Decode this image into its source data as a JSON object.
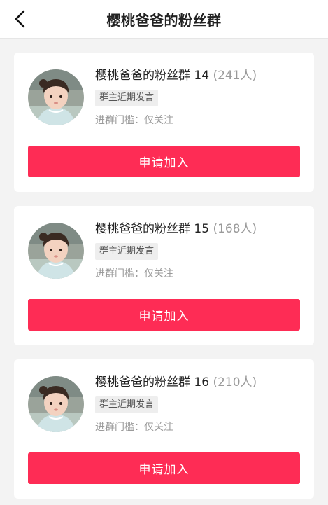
{
  "header": {
    "title": "樱桃爸爸的粉丝群",
    "back_icon": "chevron-left-icon"
  },
  "groups": [
    {
      "name": "樱桃爸爸的粉丝群 14",
      "count": "(241人)",
      "tag": "群主近期发言",
      "condition": "进群门槛：仅关注",
      "join_label": "申请加入"
    },
    {
      "name": "樱桃爸爸的粉丝群 15",
      "count": "(168人)",
      "tag": "群主近期发言",
      "condition": "进群门槛：仅关注",
      "join_label": "申请加入"
    },
    {
      "name": "樱桃爸爸的粉丝群 16",
      "count": "(210人)",
      "tag": "群主近期发言",
      "condition": "进群门槛：仅关注",
      "join_label": "申请加入"
    }
  ],
  "colors": {
    "accent": "#fe2c55",
    "background": "#f3f3f3",
    "muted_text": "#9a9a9a"
  }
}
